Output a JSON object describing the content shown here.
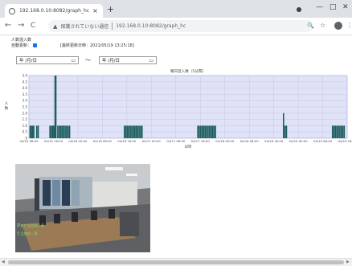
{
  "browser": {
    "tab_title": "192.168.0.10:8082/graph_hc",
    "tab_close": "×",
    "new_tab": "+",
    "minimize": "—",
    "maximize": "□",
    "close": "✕",
    "back": "←",
    "forward": "→",
    "reload": "C",
    "security_icon": "▲",
    "security_text": "保護されていない通信",
    "url": "192.168.0.10:8082/graph_hc",
    "search_icon": "🔍",
    "star_icon": "☆",
    "menu_icon": "⋮"
  },
  "controls": {
    "people_count_label": "人数混入数",
    "auto_update_label": "自動更新：",
    "last_update_label": "[最終更新日時：2021/05/19 13:25:18]",
    "start_date": "年 /月/日",
    "end_date": "年 /月/日",
    "calendar_glyph": "▭",
    "range_sep": "〜"
  },
  "chart_data": {
    "type": "bar",
    "title": "曜日混入数（5分間）",
    "xlabel": "日時",
    "ylabel": "人\n数",
    "ylim": [
      0,
      5
    ],
    "yticks": [
      "0",
      "0.5",
      "1.0",
      "1.5",
      "2.0",
      "2.5",
      "3.0",
      "3.5",
      "4.0",
      "4.5",
      "5.0"
    ],
    "xticks": [
      "04/15 08:00",
      "04/15 16:00",
      "04/16 00:00",
      "04/16 08:00",
      "04/16 16:00",
      "04/17 00:00",
      "04/17 08:00",
      "04/17 16:00",
      "04/18 00:00",
      "04/18 08:00",
      "04/18 16:00",
      "04/19 00:00",
      "04/19 08:00",
      "04/19 16:00"
    ],
    "x_range": [
      0,
      13
    ],
    "bar_color": "#1b5d5d",
    "plot_bg": "#e0e2f7",
    "bars": [
      {
        "x": 0.05,
        "v": 1
      },
      {
        "x": 0.1,
        "v": 1
      },
      {
        "x": 0.15,
        "v": 1
      },
      {
        "x": 0.2,
        "v": 1
      },
      {
        "x": 0.32,
        "v": 1
      },
      {
        "x": 0.38,
        "v": 1
      },
      {
        "x": 0.86,
        "v": 1
      },
      {
        "x": 0.92,
        "v": 1
      },
      {
        "x": 0.97,
        "v": 1
      },
      {
        "x": 1.02,
        "v": 1
      },
      {
        "x": 1.07,
        "v": 5
      },
      {
        "x": 1.1,
        "v": 5
      },
      {
        "x": 1.18,
        "v": 1
      },
      {
        "x": 1.24,
        "v": 1
      },
      {
        "x": 1.3,
        "v": 1
      },
      {
        "x": 1.36,
        "v": 1
      },
      {
        "x": 1.42,
        "v": 1
      },
      {
        "x": 1.48,
        "v": 1
      },
      {
        "x": 1.54,
        "v": 1
      },
      {
        "x": 1.6,
        "v": 1
      },
      {
        "x": 1.66,
        "v": 1
      },
      {
        "x": 3.9,
        "v": 1
      },
      {
        "x": 3.96,
        "v": 1
      },
      {
        "x": 4.02,
        "v": 1
      },
      {
        "x": 4.08,
        "v": 1
      },
      {
        "x": 4.14,
        "v": 1
      },
      {
        "x": 4.2,
        "v": 1
      },
      {
        "x": 4.26,
        "v": 1
      },
      {
        "x": 4.32,
        "v": 1
      },
      {
        "x": 4.38,
        "v": 1
      },
      {
        "x": 4.44,
        "v": 1
      },
      {
        "x": 4.5,
        "v": 1
      },
      {
        "x": 4.56,
        "v": 1
      },
      {
        "x": 4.62,
        "v": 1
      },
      {
        "x": 6.9,
        "v": 1
      },
      {
        "x": 6.96,
        "v": 1
      },
      {
        "x": 7.02,
        "v": 1
      },
      {
        "x": 7.08,
        "v": 1
      },
      {
        "x": 7.14,
        "v": 1
      },
      {
        "x": 7.2,
        "v": 1
      },
      {
        "x": 7.26,
        "v": 1
      },
      {
        "x": 7.32,
        "v": 1
      },
      {
        "x": 7.38,
        "v": 1
      },
      {
        "x": 7.44,
        "v": 1
      },
      {
        "x": 7.5,
        "v": 1
      },
      {
        "x": 7.56,
        "v": 1
      },
      {
        "x": 7.62,
        "v": 1
      },
      {
        "x": 10.4,
        "v": 2
      },
      {
        "x": 10.46,
        "v": 1
      },
      {
        "x": 10.52,
        "v": 1
      },
      {
        "x": 12.4,
        "v": 1
      },
      {
        "x": 12.46,
        "v": 1
      },
      {
        "x": 12.52,
        "v": 1
      },
      {
        "x": 12.58,
        "v": 1
      },
      {
        "x": 12.64,
        "v": 1
      },
      {
        "x": 12.7,
        "v": 1
      },
      {
        "x": 12.76,
        "v": 1
      },
      {
        "x": 12.82,
        "v": 1
      },
      {
        "x": 12.88,
        "v": 1
      }
    ]
  },
  "camera": {
    "overlay_line1": "Person:4",
    "overlay_line2": "time:0"
  },
  "scrollbar": {
    "left_arrow": "◀",
    "right_arrow": "▶"
  }
}
